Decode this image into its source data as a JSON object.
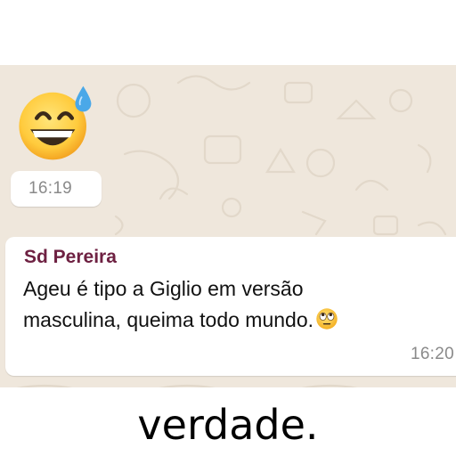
{
  "messages": [
    {
      "type": "emoji",
      "emoji": "grinning-face-with-sweat-icon",
      "time": "16:19"
    },
    {
      "type": "text",
      "sender": "Sd Pereira",
      "line1": "Ageu é tipo a Giglio em versão",
      "line2": "masculina, queima todo mundo.",
      "trailing_emoji": "face-with-rolling-eyes-icon",
      "time": "16:20"
    }
  ],
  "caption": "verdade.",
  "colors": {
    "wallpaper": "#efe7dc",
    "bubble": "#ffffff",
    "sender": "#6e2142",
    "timestamp": "#8a8a8a"
  }
}
